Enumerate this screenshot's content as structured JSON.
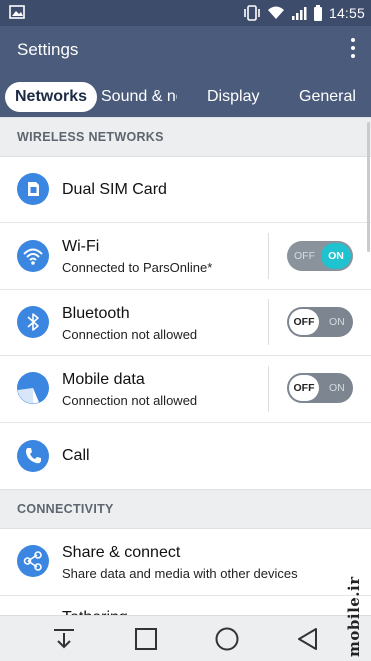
{
  "status_bar": {
    "time": "14:55",
    "left_icon": "image-icon",
    "icons": [
      "vibrate-icon",
      "wifi-icon",
      "signal-icon",
      "battery-icon"
    ]
  },
  "app_bar": {
    "title": "Settings",
    "overflow_icon": "more-vert-icon"
  },
  "tabs": [
    {
      "label": "Networks",
      "active": true
    },
    {
      "label": "Sound & no",
      "active": false
    },
    {
      "label": "Display",
      "active": false
    },
    {
      "label": "General",
      "active": false
    }
  ],
  "sections": {
    "wireless": {
      "header": "WIRELESS NETWORKS"
    },
    "connectivity": {
      "header": "CONNECTIVITY"
    }
  },
  "items": {
    "dual_sim": {
      "title": "Dual SIM Card",
      "icon": "sim-card-icon"
    },
    "wifi": {
      "title": "Wi-Fi",
      "subtitle": "Connected to ParsOnline*",
      "icon": "wifi-icon",
      "toggle": "on",
      "toggle_on_label": "ON",
      "toggle_off_label": "OFF"
    },
    "bluetooth": {
      "title": "Bluetooth",
      "subtitle": "Connection not allowed",
      "icon": "bluetooth-icon",
      "toggle": "off",
      "toggle_on_label": "ON",
      "toggle_off_label": "OFF"
    },
    "mobile_data": {
      "title": "Mobile data",
      "subtitle": "Connection not allowed",
      "icon": "mobile-data-icon",
      "toggle": "off",
      "toggle_on_label": "ON",
      "toggle_off_label": "OFF"
    },
    "call": {
      "title": "Call",
      "icon": "phone-icon"
    },
    "share": {
      "title": "Share & connect",
      "subtitle": "Share data and media with other devices",
      "icon": "share-icon"
    },
    "tethering": {
      "title": "Tethering"
    }
  },
  "nav_bar": {
    "buttons": [
      "download-icon",
      "recents-icon",
      "home-icon",
      "back-icon"
    ]
  },
  "watermark": "mobile.ir",
  "colors": {
    "status_bar": "#3e4c6b",
    "app_bar": "#4b5b7b",
    "icon_blue": "#3a86e0",
    "toggle_on": "#1fc3d0",
    "section_bg": "#eceeef"
  }
}
